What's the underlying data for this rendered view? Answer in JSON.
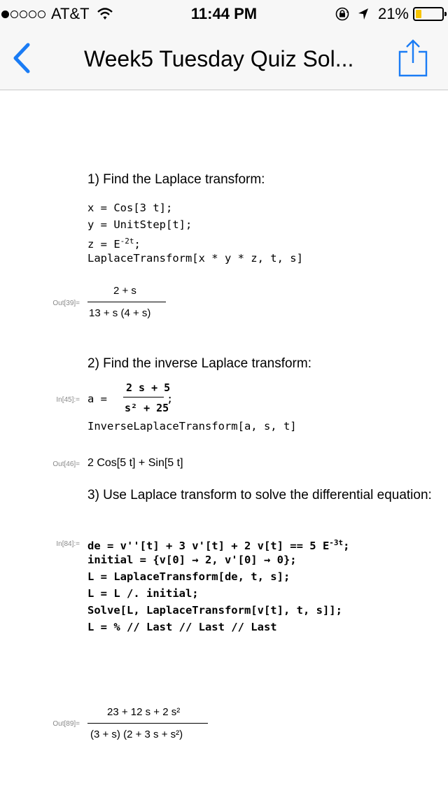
{
  "status_bar": {
    "carrier": "AT&T",
    "time": "11:44 PM",
    "battery_percent": "21%",
    "battery_level": 0.21,
    "signal_bars_filled": 1,
    "signal_bars_total": 5
  },
  "nav": {
    "title": "Week5 Tuesday Quiz Sol...",
    "accent_color": "#1a7cf5"
  },
  "questions": {
    "q1": {
      "text": "1) Find the Laplace transform:",
      "lines": [
        "x = Cos[3 t];",
        "y = UnitStep[t];",
        "z = E",
        "LaplaceTransform[x * y * z, t, s]"
      ],
      "exponent": "-2t",
      "exponent_suffix": ";",
      "out_label": "Out[39]=",
      "out_numerator": "2 + s",
      "out_denominator": "13 + s (4 + s)"
    },
    "q2": {
      "text": "2) Find the inverse Laplace transform:",
      "in_label": "In[45]:=",
      "a_def": "a  =",
      "numerator": "2 s + 5",
      "denominator": "s² + 25",
      "suffix": ";",
      "line2": "InverseLaplaceTransform[a, s, t]",
      "out_label": "Out[46]=",
      "output": "2 Cos[5 t] + Sin[5 t]"
    },
    "q3": {
      "text": "3) Use Laplace transform to solve the differential equation:",
      "in_label": "In[84]:=",
      "line1": "de = v''[t] + 3 v'[t] + 2 v[t] == 5 E",
      "line1_exp": "-3t",
      "line1_suffix": ";",
      "lines": [
        "initial = {v[0] → 2, v'[0] → 0};",
        "L = LaplaceTransform[de, t, s];",
        "L = L /. initial;",
        "Solve[L, LaplaceTransform[v[t], t, s]];",
        "L = % // Last // Last // Last"
      ],
      "out_label": "Out[89]=",
      "out_numerator": "23 + 12 s + 2 s²",
      "out_denominator": "(3 + s) (2 + 3 s + s²)"
    }
  }
}
